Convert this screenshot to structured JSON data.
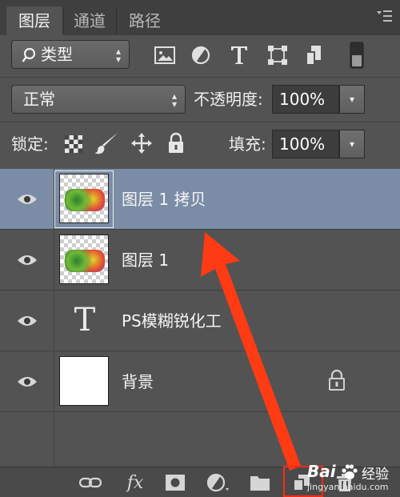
{
  "tabs": [
    {
      "label": "图层",
      "active": true
    },
    {
      "label": "通道",
      "active": false
    },
    {
      "label": "路径",
      "active": false
    }
  ],
  "filter": {
    "label": "类型",
    "icons": [
      "image-filter-icon",
      "adjustment-filter-icon",
      "type-filter-icon",
      "shape-filter-icon",
      "smart-object-filter-icon",
      "filter-toggle-icon"
    ]
  },
  "blend": {
    "mode": "正常",
    "opacity_label": "不透明度:",
    "opacity_value": "100%"
  },
  "lock": {
    "label": "锁定:",
    "fill_label": "填充:",
    "fill_value": "100%"
  },
  "layers": [
    {
      "name": "图层 1 拷贝",
      "selected": true,
      "type": "image"
    },
    {
      "name": "图层 1",
      "selected": false,
      "type": "image"
    },
    {
      "name": "PS模糊锐化工",
      "selected": false,
      "type": "text",
      "glyph": "T"
    },
    {
      "name": "背景",
      "selected": false,
      "type": "background",
      "locked": true
    }
  ],
  "bottom_icons": [
    "link-layers-icon",
    "fx-icon",
    "layer-mask-icon",
    "adjustment-layer-icon",
    "new-group-icon",
    "new-layer-icon",
    "delete-layer-icon"
  ],
  "fx_label": "fx",
  "watermark": {
    "logo": "Bai",
    "text": "经验",
    "url": "jingyan.baidu.com"
  },
  "colors": {
    "panel": "#535353",
    "selected_row": "#7a8ca6",
    "annotation": "#ff2a10"
  }
}
